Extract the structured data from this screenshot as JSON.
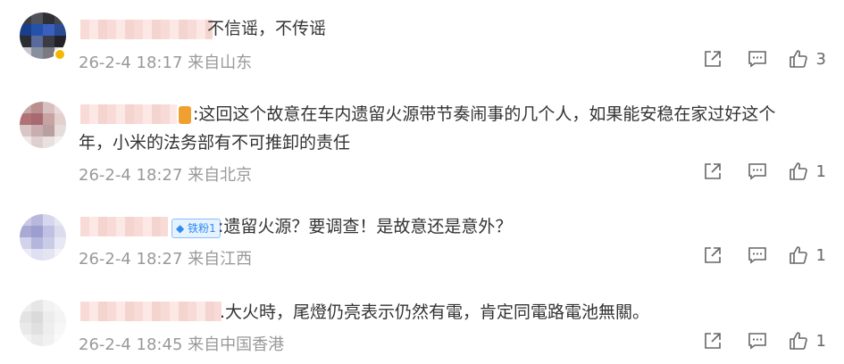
{
  "comments": [
    {
      "text": "不信谣，不传谣",
      "date": "26-2-4 18:17",
      "location": "来自山东",
      "likes": "3"
    },
    {
      "text_line1": ":这回这个故意在车内遗留火源带节奏闹事的几个人，如果能安稳在家过好这个",
      "text_line2": "年，小米的法务部有不可推卸的责任",
      "date": "26-2-4 18:27",
      "location": "来自北京",
      "likes": "1"
    },
    {
      "fan_badge": "铁粉1",
      "text": ":遗留火源？要调查！是故意还是意外？",
      "date": "26-2-4 18:27",
      "location": "来自江西",
      "likes": "1"
    },
    {
      "text": ".大火時，尾燈仍亮表示仍然有電，肯定同電路電池無關。",
      "date": "26-2-4 18:45",
      "location": "来自中国香港",
      "likes": "1"
    }
  ],
  "icons": {
    "share": "share-icon",
    "comment": "comment-icon",
    "like": "thumbs-up-icon"
  }
}
